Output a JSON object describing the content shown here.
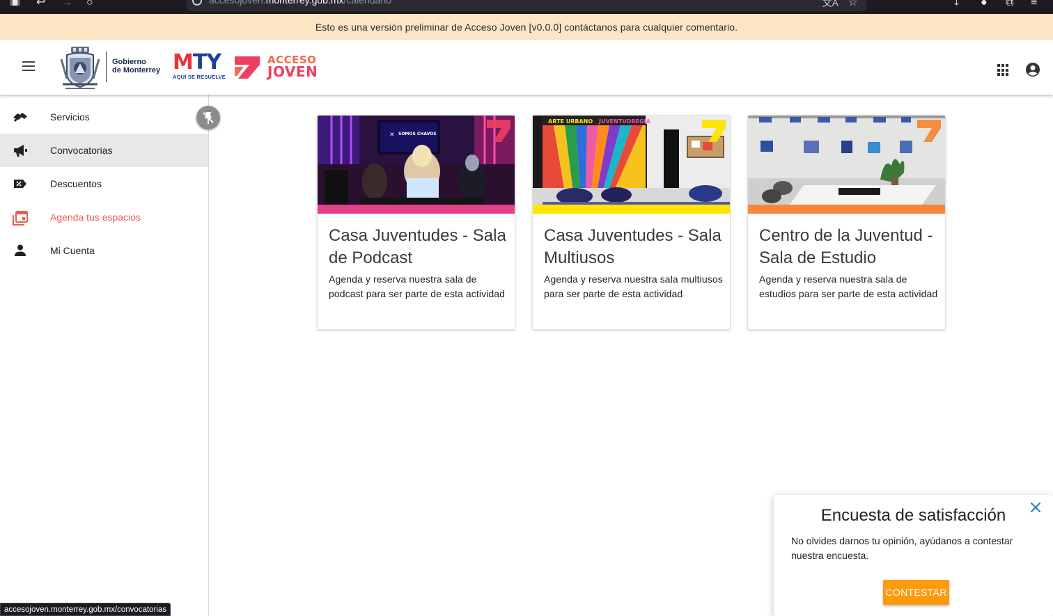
{
  "browser": {
    "url_prefix": "accesojoven.",
    "url_domain": "monterrey.gob.mx",
    "url_path": "/calendario",
    "status_link": "accesojoven.monterrey.gob.mx/convocatorias"
  },
  "banner": {
    "text": "Esto es una versión preliminar de Acceso Joven [v0.0.0] contáctanos para cualquier comentario."
  },
  "header": {
    "gov_line1": "Gobierno",
    "gov_line2": "de Monterrey",
    "mty_m": "M",
    "mty_t": "T",
    "mty_y": "Y",
    "mty_sub": "AQUÍ SE RESUELVE",
    "acceso": "ACCESO",
    "joven": "JOVEN"
  },
  "sidebar": {
    "items": [
      {
        "label": "Servicios",
        "icon": "handshake-icon"
      },
      {
        "label": "Convocatorias",
        "icon": "megaphone-icon"
      },
      {
        "label": "Descuentos",
        "icon": "discount-tag-icon"
      },
      {
        "label": "Agenda tus espacios",
        "icon": "calendar-icon"
      },
      {
        "label": "Mi Cuenta",
        "icon": "person-icon"
      }
    ],
    "active_index": 1,
    "highlight_index": 3,
    "highlight_color": "#e85d55"
  },
  "cards": [
    {
      "title": "Casa Juventudes - Sala de Podcast",
      "description": "Agenda y reserva nuestra sala de podcast para ser parte de esta actividad",
      "stripe_color": "#e83e8c",
      "photo_screen_text": "SOMOS CHAVOS"
    },
    {
      "title": "Casa Juventudes - Sala Multiusos",
      "description": "Agenda y reserva nuestra sala multiusos para ser parte de esta actividad",
      "stripe_color": "#ffe500",
      "photo_wall_text_left": "ARTE URBANO",
      "photo_wall_text_right": "JUVENTUDREGIA"
    },
    {
      "title": "Centro de la Juventud - Sala de Estudio",
      "description": "Agenda y reserva nuestra sala de estudios para ser parte de esta actividad",
      "stripe_color": "#f5883a"
    }
  ],
  "survey": {
    "title": "Encuesta de satisfacción",
    "text": "No olvides darnos tu opinión, ayúdanos a contestar nuestra encuesta.",
    "button": "CONTESTAR",
    "button_color": "#ff9a0c",
    "close_color": "#2b7bd6"
  }
}
